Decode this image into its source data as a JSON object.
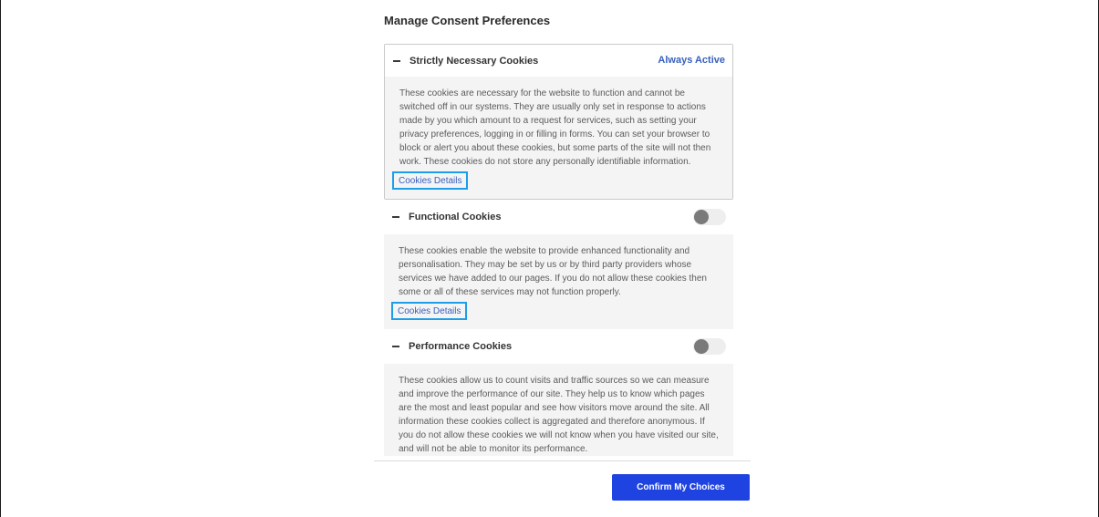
{
  "title": "Manage Consent Preferences",
  "sections": [
    {
      "title": "Strictly Necessary Cookies",
      "status": "Always Active",
      "description": "These cookies are necessary for the website to function and cannot be switched off in our systems. They are usually only set in response to actions made by you which amount to a request for services, such as setting your privacy preferences, logging in or filling in forms. You can set your browser to block or alert you about these cookies, but some parts of the site will not then work. These cookies do not store any personally identifiable information.",
      "details_link": "Cookies Details"
    },
    {
      "title": "Functional Cookies",
      "toggle_on": false,
      "description": "These cookies enable the website to provide enhanced functionality and personalisation. They may be set by us or by third party providers whose services we have added to our pages. If you do not allow these cookies then some or all of these services may not function properly.",
      "details_link": "Cookies Details"
    },
    {
      "title": "Performance Cookies",
      "toggle_on": false,
      "description": "These cookies allow us to count visits and traffic sources so we can measure and improve the performance of our site. They help us to know which pages are the most and least popular and see how visitors move around the site. All information these cookies collect is aggregated and therefore anonymous. If you do not allow these cookies we will not know when you have visited our site, and will not be able to monitor its performance."
    }
  ],
  "confirm_button": "Confirm My Choices",
  "colors": {
    "accent": "#1f43e0",
    "link": "#3860be",
    "focus_outline": "#1e9ee8"
  }
}
